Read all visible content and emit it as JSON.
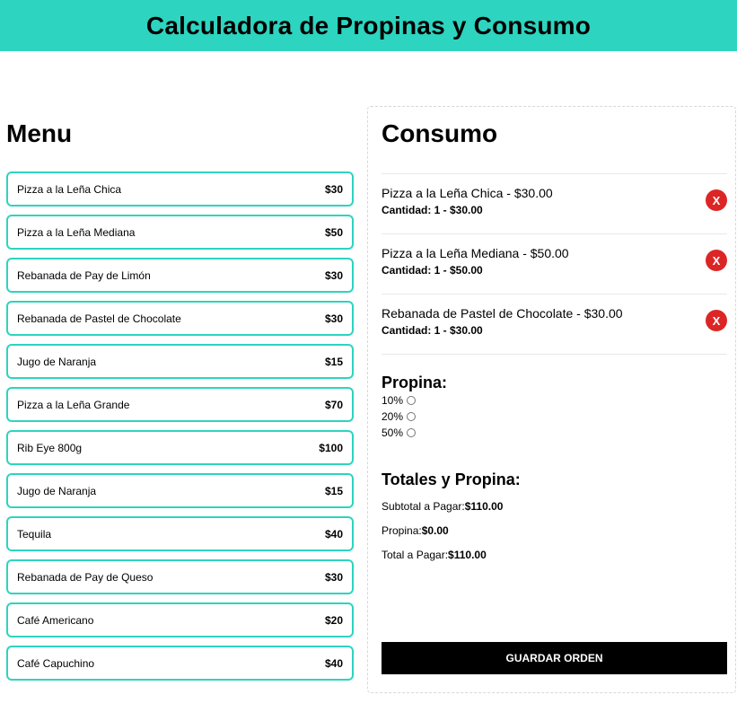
{
  "header": {
    "title": "Calculadora de Propinas y Consumo"
  },
  "menu": {
    "title": "Menu",
    "items": [
      {
        "name": "Pizza a la Leña Chica",
        "price": "$30"
      },
      {
        "name": "Pizza a la Leña Mediana",
        "price": "$50"
      },
      {
        "name": "Rebanada de Pay de Limón",
        "price": "$30"
      },
      {
        "name": "Rebanada de Pastel de Chocolate",
        "price": "$30"
      },
      {
        "name": "Jugo de Naranja",
        "price": "$15"
      },
      {
        "name": "Pizza a la Leña Grande",
        "price": "$70"
      },
      {
        "name": "Rib Eye 800g",
        "price": "$100"
      },
      {
        "name": "Jugo de Naranja",
        "price": "$15"
      },
      {
        "name": "Tequila",
        "price": "$40"
      },
      {
        "name": "Rebanada de Pay de Queso",
        "price": "$30"
      },
      {
        "name": "Café Americano",
        "price": "$20"
      },
      {
        "name": "Café Capuchino",
        "price": "$40"
      }
    ]
  },
  "consumo": {
    "title": "Consumo",
    "orders": [
      {
        "title": "Pizza a la Leña Chica - $30.00",
        "qty": "Cantidad: 1 - $30.00",
        "remove": "X"
      },
      {
        "title": "Pizza a la Leña Mediana - $50.00",
        "qty": "Cantidad: 1 - $50.00",
        "remove": "X"
      },
      {
        "title": "Rebanada de Pastel de Chocolate - $30.00",
        "qty": "Cantidad: 1 - $30.00",
        "remove": "X"
      }
    ]
  },
  "tip": {
    "title": "Propina:",
    "options": [
      "10%",
      "20%",
      "50%"
    ]
  },
  "totals": {
    "title": "Totales y Propina:",
    "subtotal_label": "Subtotal a Pagar:",
    "subtotal_value": "$110.00",
    "tip_label": "Propina:",
    "tip_value": "$0.00",
    "total_label": "Total a Pagar:",
    "total_value": "$110.00"
  },
  "actions": {
    "save_label": "GUARDAR ORDEN"
  },
  "colors": {
    "accent": "#2dd4bf",
    "danger": "#dc2626",
    "button": "#000000"
  }
}
